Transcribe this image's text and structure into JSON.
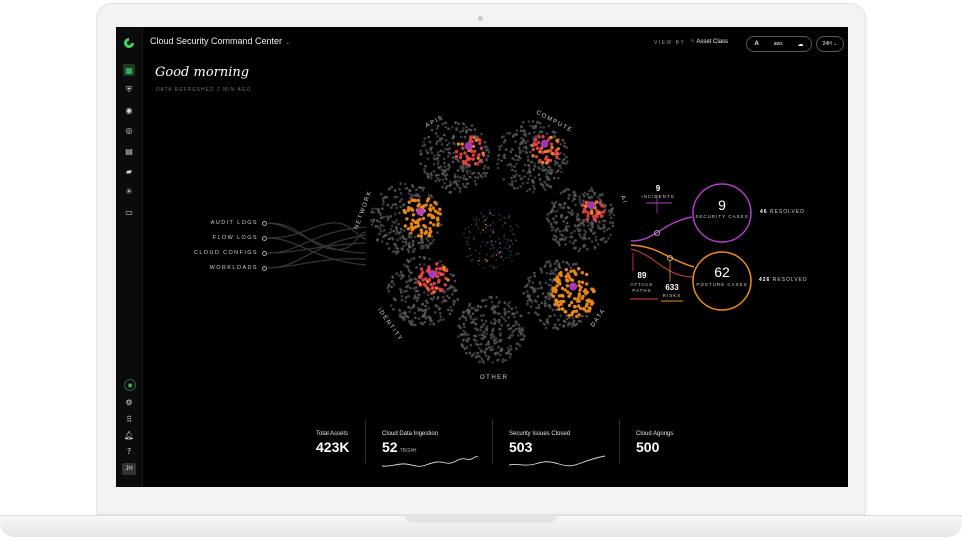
{
  "app": {
    "title": "Cloud Security Command Center"
  },
  "header": {
    "view_by_label": "VIEW BY",
    "view_by_value": "Asset Class",
    "clouds": [
      "A",
      "aws",
      "cloud-icon"
    ],
    "time_range": "24H"
  },
  "sidebar": {
    "top_icons": [
      "grid-icon",
      "shield-icon",
      "eye-icon",
      "target-icon",
      "document-icon",
      "folder-icon",
      "network-icon",
      "window-icon"
    ],
    "bottom_icons": [
      "assistant-icon",
      "gear-icon",
      "apps-icon",
      "bell-icon",
      "help-icon"
    ],
    "avatar": "JH"
  },
  "main": {
    "greeting": "Good morning",
    "refreshed": "DATA REFRESHED 2 MIN AGO"
  },
  "sources": [
    "AUDIT LOGS",
    "FLOW LOGS",
    "CLOUD CONFIGS",
    "WORKLOADS"
  ],
  "clusters": [
    "APIS",
    "COMPUTE",
    "AI",
    "DATA",
    "OTHER",
    "IDENTITY",
    "NETWORK"
  ],
  "findings": {
    "incidents": {
      "value": "9",
      "label": "INCIDENTS"
    },
    "attack_paths": {
      "value": "89",
      "label": "ATTACK PATHS"
    },
    "risks": {
      "value": "633",
      "label": "RISKS"
    },
    "security_cases": {
      "value": "9",
      "label": "SECURITY CASES",
      "resolved_count": "46",
      "resolved_label": "RESOLVED"
    },
    "posture_cases": {
      "value": "62",
      "label": "POSTURE CASES",
      "resolved_count": "426",
      "resolved_label": "RESOLVED"
    }
  },
  "kpis": [
    {
      "label": "Total Assets",
      "value": "423K",
      "unit": ""
    },
    {
      "label": "Cloud Data Ingestion",
      "value": "52",
      "unit": "TB/24H"
    },
    {
      "label": "Security Issues Closed",
      "value": "503",
      "unit": ""
    },
    {
      "label": "Cloud Agongs",
      "value": "500",
      "unit": ""
    }
  ],
  "colors": {
    "accent": "#3fd46b",
    "security": "#b23cc8",
    "posture": "#f08a1a",
    "alert": "#e0414b",
    "node": "#5a5d62"
  }
}
